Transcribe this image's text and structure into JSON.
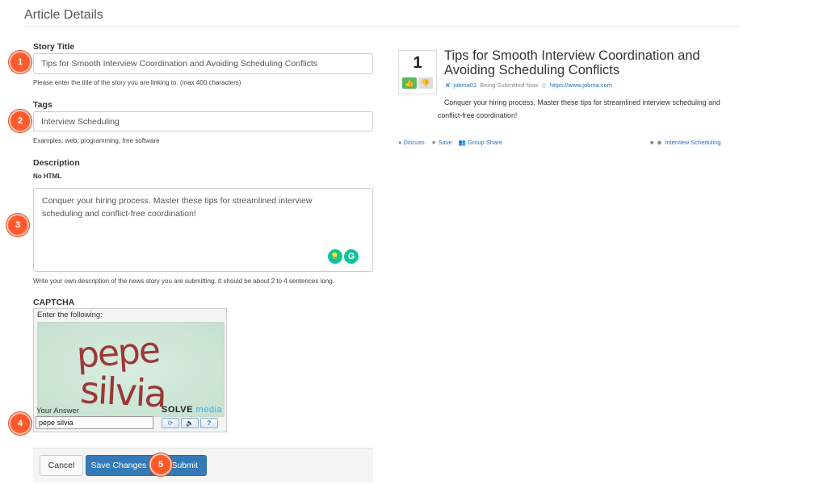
{
  "page": {
    "title": "Article Details"
  },
  "form": {
    "story_title": {
      "label": "Story Title",
      "value": "Tips for Smooth Interview Coordination and Avoiding Scheduling Conflicts",
      "help": "Please enter the title of the story you are linking to. (max 400 characters)"
    },
    "tags": {
      "label": "Tags",
      "value": "Interview Scheduling",
      "help": "Examples: web, programming, free software"
    },
    "description": {
      "label": "Description",
      "sublabel": "No HTML",
      "value": "Conquer your hiring process. Master these tips for streamlined interview scheduling and conflict-free coordination!",
      "help": "Write your own description of the news story you are submitting. It should be about 2 to 4 sentences long."
    },
    "captcha": {
      "label": "CAPTCHA",
      "prompt": "Enter the following:",
      "image_text_line1": "pepe",
      "image_text_line2": "silvia",
      "answer_label": "Your Answer",
      "answer_value": "pepe silvia",
      "brand_solve": "SOLVE",
      "brand_media": "media",
      "btn_refresh": "⟳",
      "btn_audio": "🔈",
      "btn_help": "?"
    },
    "buttons": {
      "cancel": "Cancel",
      "save": "Save Changes",
      "submit": "Submit"
    }
  },
  "steps": [
    "1",
    "2",
    "3",
    "4",
    "5"
  ],
  "grammarly": {
    "bulb": "💡",
    "g": "G"
  },
  "preview": {
    "votes": "1",
    "thumb_up": "👍",
    "thumb_down": "👎",
    "title": "Tips for Smooth Interview Coordination and Avoiding Scheduling Conflicts",
    "user": "jobma01",
    "status": "Being Submitted Now",
    "url": "https://www.jobma.com",
    "description": "Conquer your hiring process. Master these tips for streamlined interview scheduling and conflict-free coordination!",
    "actions": {
      "discuss": "Discuss",
      "save": "Save",
      "group_share": "Group Share"
    },
    "tag": "Interview Scheduling"
  },
  "colors": {
    "step_badge": "#ff5a2c",
    "primary_button": "#337ab7",
    "link": "#2a6ebb",
    "vote_up": "#5cb85c",
    "captcha_text": "#9a3a38"
  }
}
